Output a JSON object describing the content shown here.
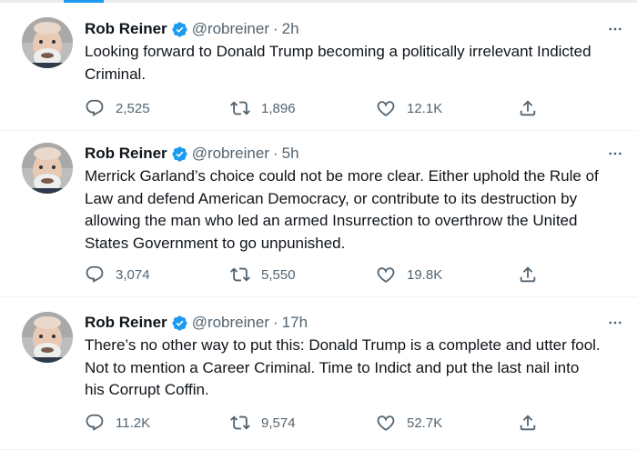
{
  "tweets": [
    {
      "name": "Rob Reiner",
      "handle": "@robreiner",
      "separator": "·",
      "time": "2h",
      "text_lines": [
        "Looking forward to Donald Trump becoming a politically irrelevant Indicted",
        "Criminal."
      ],
      "replies": "2,525",
      "retweets": "1,896",
      "likes": "12.1K"
    },
    {
      "name": "Rob Reiner",
      "handle": "@robreiner",
      "separator": "·",
      "time": "5h",
      "text_lines": [
        "Merrick Garland’s choice could not be more clear. Either uphold the Rule of",
        "Law and defend American Democracy, or contribute to its destruction by",
        "allowing the man who led an armed Insurrection to overthrow the United",
        "States Government to go unpunished."
      ],
      "replies": "3,074",
      "retweets": "5,550",
      "likes": "19.8K"
    },
    {
      "name": "Rob Reiner",
      "handle": "@robreiner",
      "separator": "·",
      "time": "17h",
      "text_lines": [
        "There’s no other way to put this: Donald Trump is a complete and utter fool.",
        "Not to mention a Career Criminal. Time to Indict and put the last nail into",
        "his Corrupt Coffin."
      ],
      "replies": "11.2K",
      "retweets": "9,574",
      "likes": "52.7K"
    }
  ],
  "icons": {
    "verified": "verified-badge-icon",
    "more": "more-horizontal-icon",
    "reply": "reply-bubble-icon",
    "retweet": "retweet-icon",
    "like": "heart-icon",
    "share": "share-upload-icon"
  },
  "colors": {
    "text": "#0f1419",
    "secondary": "#536471",
    "verified": "#1d9bf0",
    "divider": "#eff3f4"
  }
}
